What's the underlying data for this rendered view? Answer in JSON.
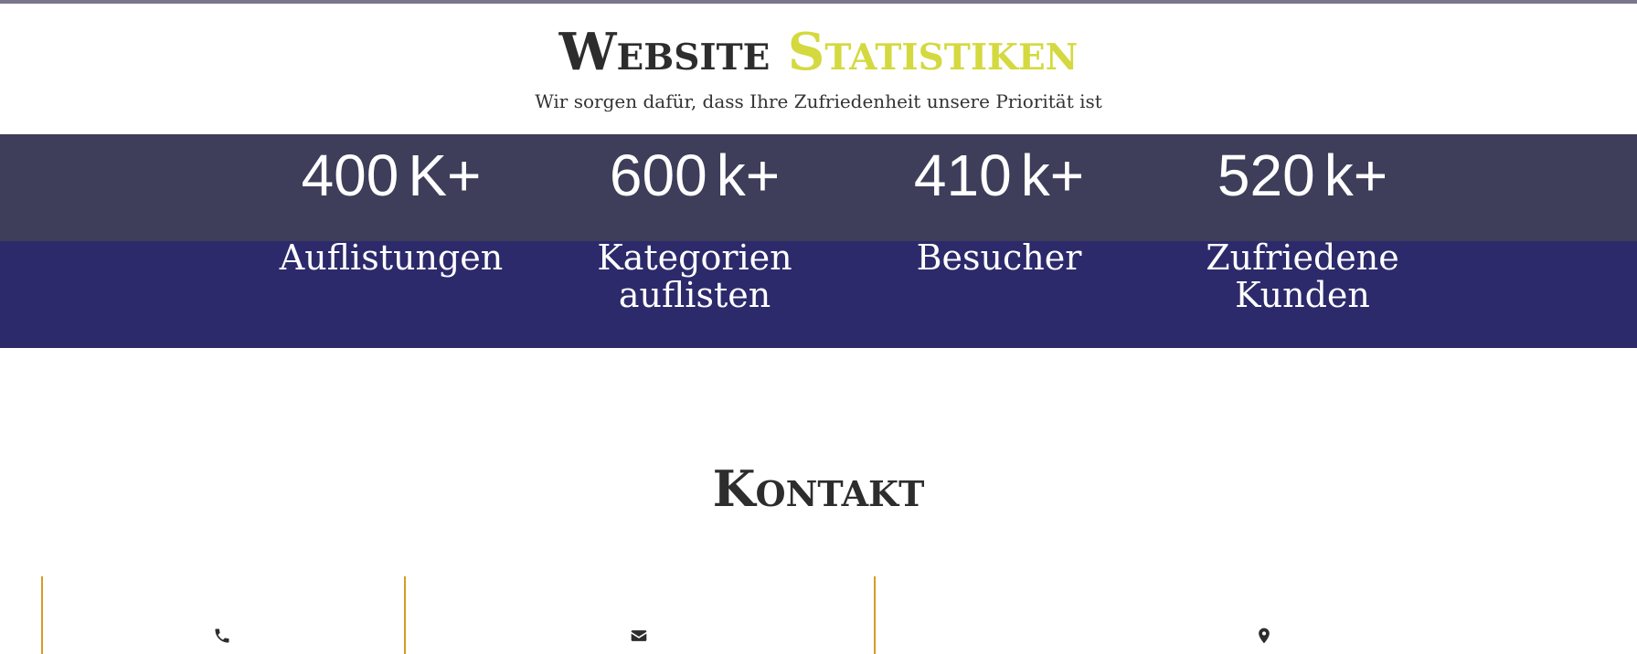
{
  "stats_section": {
    "title_main": "Website",
    "title_accent": "Statistiken",
    "subtitle": "Wir sorgen dafür, dass Ihre Zufriedenheit unsere Priorität ist",
    "colors": {
      "band_top": "#3e3d5a",
      "band_bottom": "#2d2a6b",
      "accent": "#d4d93f"
    },
    "items": [
      {
        "number": "400",
        "suffix": "K+",
        "label": "Auflistungen"
      },
      {
        "number": "600",
        "suffix": "k+",
        "label": "Kategorien auflisten"
      },
      {
        "number": "410",
        "suffix": "k+",
        "label": "Besucher"
      },
      {
        "number": "520",
        "suffix": "k+",
        "label": "Zufriedene Kunden"
      }
    ]
  },
  "contact_section": {
    "title": "Kontakt",
    "divider_color": "#d79a26",
    "icons": [
      "phone-icon",
      "envelope-icon",
      "map-marker-icon"
    ]
  }
}
